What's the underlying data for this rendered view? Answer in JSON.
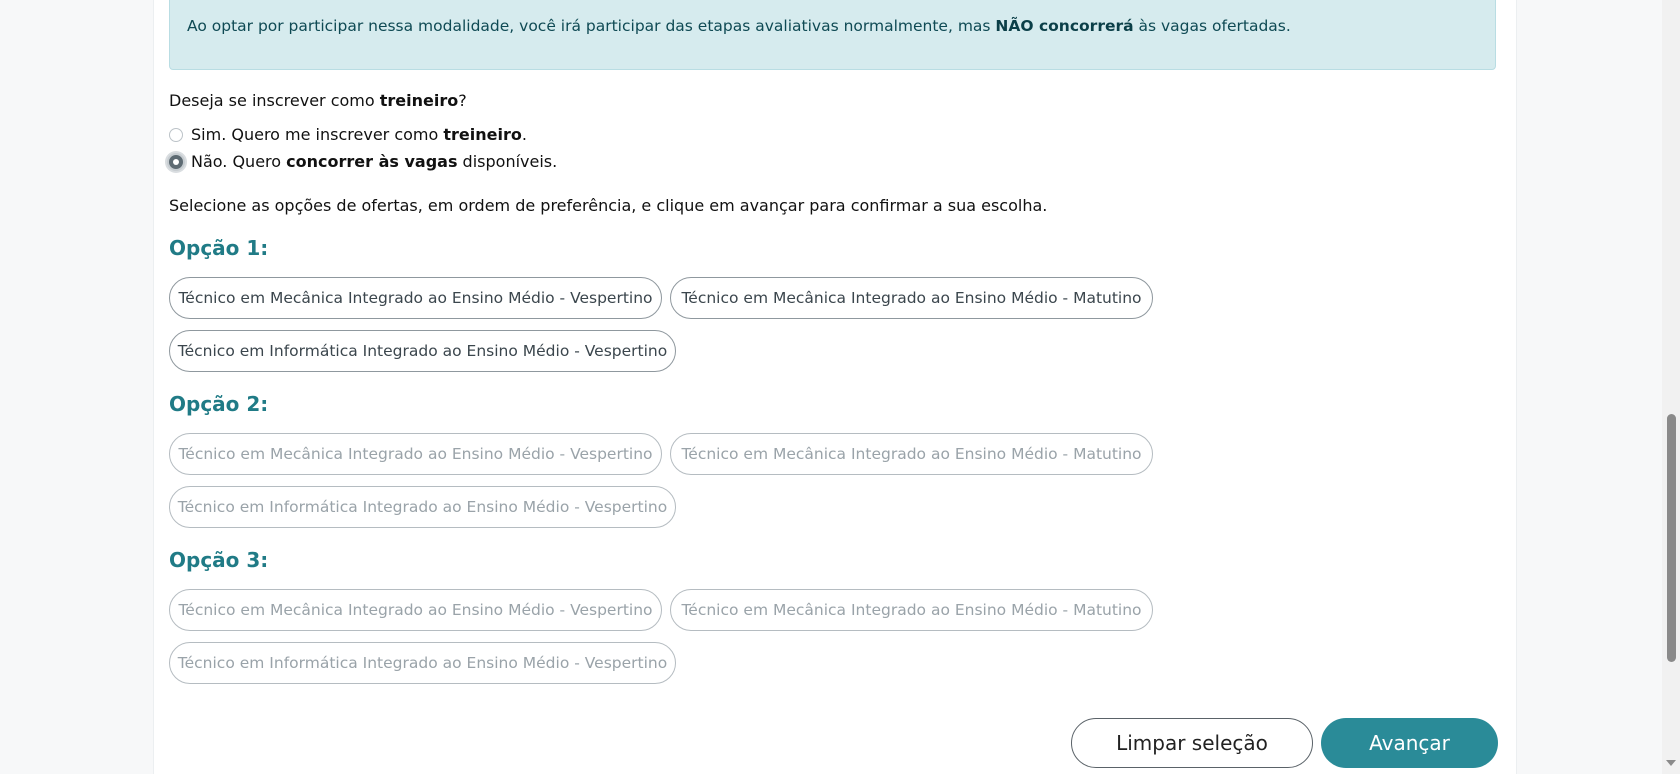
{
  "alert": {
    "text_before": "Ao optar por participar nessa modalidade, você irá participar das etapas avaliativas normalmente, mas ",
    "text_bold": "NÃO concorrerá",
    "text_after": " às vagas ofertadas."
  },
  "question": {
    "before": "Deseja se inscrever como ",
    "bold": "treineiro",
    "after": "?"
  },
  "radios": [
    {
      "before": "Sim. Quero me inscrever como ",
      "bold": "treineiro",
      "after": ".",
      "checked": false
    },
    {
      "before": "Não. Quero ",
      "bold": "concorrer às vagas",
      "after": " disponíveis.",
      "checked": true
    }
  ],
  "instruction": "Selecione as opções de ofertas, em ordem de preferência, e clique em avançar para confirmar a sua escolha.",
  "options": [
    {
      "title": "Opção 1:",
      "items": [
        "Técnico em Mecânica Integrado ao Ensino Médio - Vespertino",
        "Técnico em Mecânica Integrado ao Ensino Médio - Matutino",
        "Técnico em Informática Integrado ao Ensino Médio - Vespertino"
      ]
    },
    {
      "title": "Opção 2:",
      "items": [
        "Técnico em Mecânica Integrado ao Ensino Médio - Vespertino",
        "Técnico em Mecânica Integrado ao Ensino Médio - Matutino",
        "Técnico em Informática Integrado ao Ensino Médio - Vespertino"
      ]
    },
    {
      "title": "Opção 3:",
      "items": [
        "Técnico em Mecânica Integrado ao Ensino Médio - Vespertino",
        "Técnico em Mecânica Integrado ao Ensino Médio - Matutino",
        "Técnico em Informática Integrado ao Ensino Médio - Vespertino"
      ]
    }
  ],
  "buttons": {
    "clear": "Limpar seleção",
    "next": "Avançar"
  },
  "colors": {
    "accent": "#2a8b98",
    "heading": "#207b86",
    "alert_bg": "#d6ebee"
  }
}
